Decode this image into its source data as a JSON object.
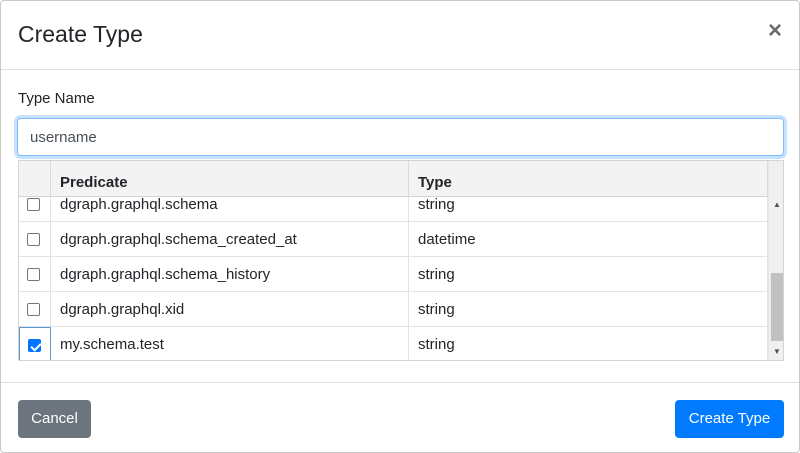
{
  "dialog": {
    "title": "Create Type",
    "close_label": "×"
  },
  "form": {
    "type_name_label": "Type Name",
    "type_name_value": "username"
  },
  "table": {
    "columns": [
      "Predicate",
      "Type"
    ],
    "rows": [
      {
        "predicate": "dgraph.graphql.schema",
        "type": "string",
        "checked": false
      },
      {
        "predicate": "dgraph.graphql.schema_created_at",
        "type": "datetime",
        "checked": false
      },
      {
        "predicate": "dgraph.graphql.schema_history",
        "type": "string",
        "checked": false
      },
      {
        "predicate": "dgraph.graphql.xid",
        "type": "string",
        "checked": false
      },
      {
        "predicate": "my.schema.test",
        "type": "string",
        "checked": true
      }
    ]
  },
  "footer": {
    "cancel_label": "Cancel",
    "create_label": "Create Type"
  },
  "colors": {
    "primary": "#007bff",
    "secondary": "#6c757d",
    "checkbox_checked": "#0075ff"
  }
}
